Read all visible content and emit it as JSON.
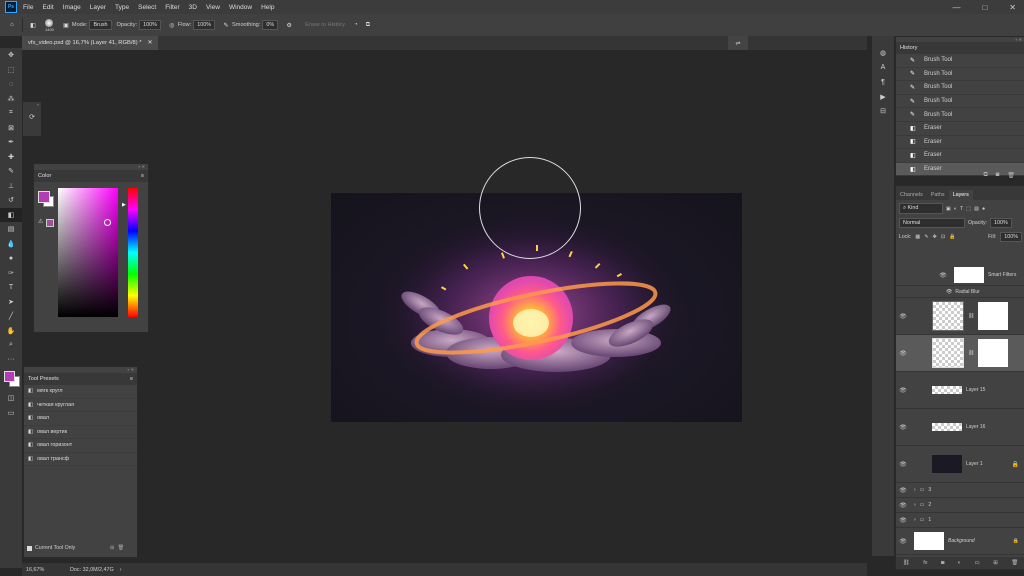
{
  "app": {
    "logo": "Ps"
  },
  "menu": [
    "File",
    "Edit",
    "Image",
    "Layer",
    "Type",
    "Select",
    "Filter",
    "3D",
    "View",
    "Window",
    "Help"
  ],
  "window_controls": {
    "minimize": "—",
    "maximize": "□",
    "close": "✕"
  },
  "options": {
    "brush_size": "1400",
    "mode_label": "Mode:",
    "mode_value": "Brush",
    "opacity_label": "Opacity:",
    "opacity_value": "100%",
    "flow_label": "Flow:",
    "flow_value": "100%",
    "smoothing_label": "Smoothing:",
    "smoothing_value": "0%",
    "erase_history": "Erase to History"
  },
  "document_tab": {
    "title": "vfx_video.psd @ 16,7% (Layer 41, RGB/8) *",
    "close": "✕"
  },
  "color_panel": {
    "title": "Color"
  },
  "tool_presets": {
    "title": "Tool Presets",
    "items": [
      "мягк кругл",
      "четкая круглая",
      "овал",
      "овал вертик",
      "овал горизонт",
      "овал трансф"
    ],
    "current_only": "Current Tool Only"
  },
  "history": {
    "title": "History",
    "items": [
      "Brush Tool",
      "Brush Tool",
      "Brush Tool",
      "Brush Tool",
      "Brush Tool",
      "Eraser",
      "Eraser",
      "Eraser",
      "Eraser"
    ]
  },
  "layers_panel": {
    "tabs": [
      "Channels",
      "Paths",
      "Layers"
    ],
    "kind": "Kind",
    "blend": "Normal",
    "opacity_label": "Opacity:",
    "opacity_value": "100%",
    "lock_label": "Lock:",
    "fill_label": "Fill:",
    "fill_value": "100%",
    "smart_filters": "Smart Filters",
    "radial_blur": "Radial Blur",
    "layers": [
      "Layer 15",
      "Layer 16",
      "Layer 1"
    ],
    "groups": [
      "3",
      "2",
      "1"
    ],
    "background": "Background"
  },
  "status": {
    "zoom": "16,67%",
    "doc": "Doc: 32,0M/2,47G"
  },
  "colors": {
    "foreground": "#b43cb4",
    "accent": "#31a8ff"
  }
}
